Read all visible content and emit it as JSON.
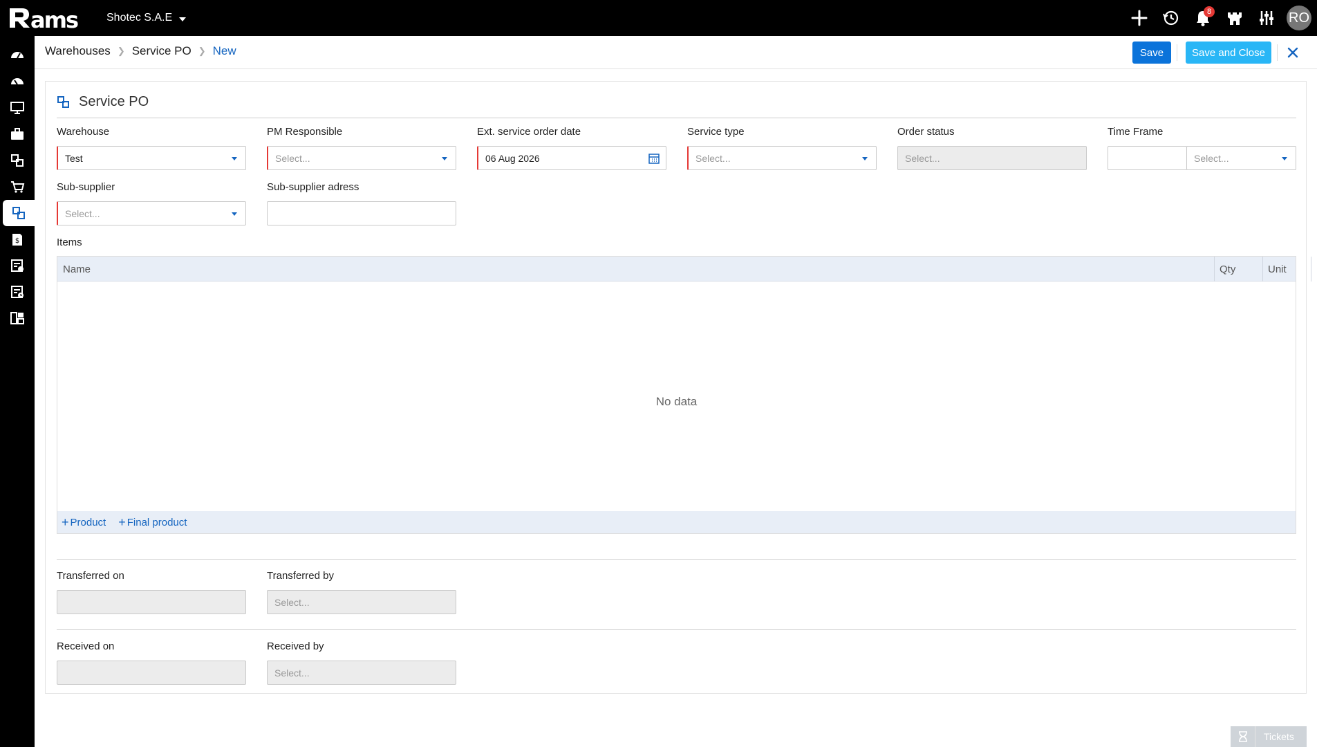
{
  "app": {
    "logo_text": "Rams",
    "company": "Shotec S.A.E",
    "notification_count": "8",
    "avatar_initials": "RO"
  },
  "top_icons": [
    "plus-icon",
    "history-icon",
    "bell-icon",
    "castle-icon",
    "sliders-icon"
  ],
  "sidebar": {
    "items": [
      {
        "icon": "dashboard-icon"
      },
      {
        "icon": "gauge-icon"
      },
      {
        "icon": "monitor-icon"
      },
      {
        "icon": "briefcase-icon"
      },
      {
        "icon": "service-po-icon",
        "active": true
      },
      {
        "icon": "cart-icon"
      },
      {
        "icon": "service-po-icon"
      },
      {
        "icon": "invoice-icon"
      },
      {
        "icon": "checklist-icon"
      },
      {
        "icon": "report-icon"
      },
      {
        "icon": "layout-icon"
      }
    ]
  },
  "breadcrumb": {
    "items": [
      "Warehouses",
      "Service PO",
      "New"
    ]
  },
  "toolbar": {
    "save_label": "Save",
    "save_close_label": "Save and Close"
  },
  "form": {
    "title": "Service PO",
    "warehouse": {
      "label": "Warehouse",
      "value": "Test"
    },
    "pm_responsible": {
      "label": "PM Responsible",
      "placeholder": "Select..."
    },
    "ext_date": {
      "label": "Ext. service order date",
      "value": "06 Aug 2026"
    },
    "service_type": {
      "label": "Service type",
      "placeholder": "Select..."
    },
    "order_status": {
      "label": "Order status",
      "placeholder": "Select..."
    },
    "time_frame": {
      "label": "Time Frame",
      "value": "",
      "unit_placeholder": "Select..."
    },
    "sub_supplier": {
      "label": "Sub-supplier",
      "placeholder": "Select..."
    },
    "sub_supplier_address": {
      "label": "Sub-supplier adress",
      "value": ""
    },
    "items": {
      "label": "Items",
      "columns": [
        "Name",
        "Qty",
        "Unit"
      ],
      "empty_text": "No data",
      "add_product": "Product",
      "add_final_product": "Final product"
    },
    "transferred_on": {
      "label": "Transferred on",
      "value": ""
    },
    "transferred_by": {
      "label": "Transferred by",
      "placeholder": "Select..."
    },
    "received_on": {
      "label": "Received on",
      "value": ""
    },
    "received_by": {
      "label": "Received by",
      "placeholder": "Select..."
    }
  },
  "tickets": {
    "label": "Tickets"
  },
  "colors": {
    "primary": "#0b73da",
    "secondary": "#29b6f6",
    "required": "#e53935",
    "link": "#1565c0"
  }
}
